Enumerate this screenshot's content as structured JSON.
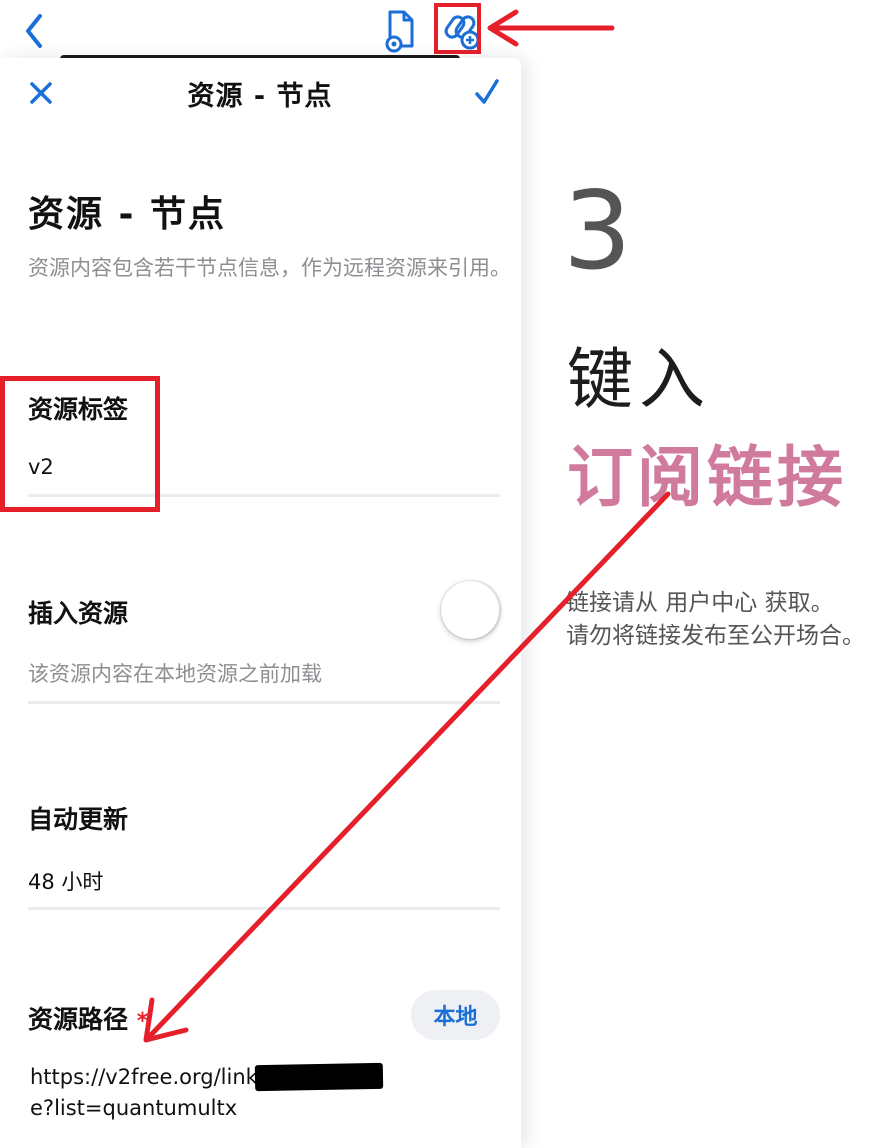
{
  "nav": {
    "title": "资源 - 节点"
  },
  "header": {
    "title": "资源 - 节点",
    "description": "资源内容包含若干节点信息，作为远程资源来引用。"
  },
  "fields": {
    "tag": {
      "label": "资源标签",
      "value": "v2"
    },
    "insert": {
      "label": "插入资源",
      "note": "该资源内容在本地资源之前加载",
      "enabled": false
    },
    "auto_update": {
      "label": "自动更新",
      "value": "48 小时"
    },
    "path": {
      "label": "资源路径",
      "required_mark": "*",
      "local_button": "本地",
      "url_prefix": "https://v2free.org/link/k",
      "url_suffix": "e?list=quantumultx"
    }
  },
  "instructions": {
    "step": "3",
    "action": "键入",
    "target": "订阅链接",
    "note_line1": "链接请从 用户中心 获取。",
    "note_line2": "请勿将链接发布至公开场合。"
  },
  "icons": {
    "back": "chevron-left-icon",
    "doc_settings": "document-gear-icon",
    "link_add": "link-add-icon",
    "close": "close-icon",
    "confirm": "checkmark-icon"
  },
  "colors": {
    "accent": "#1b6fd8",
    "highlight": "#e5202b",
    "emphasis": "#d07b9e"
  }
}
